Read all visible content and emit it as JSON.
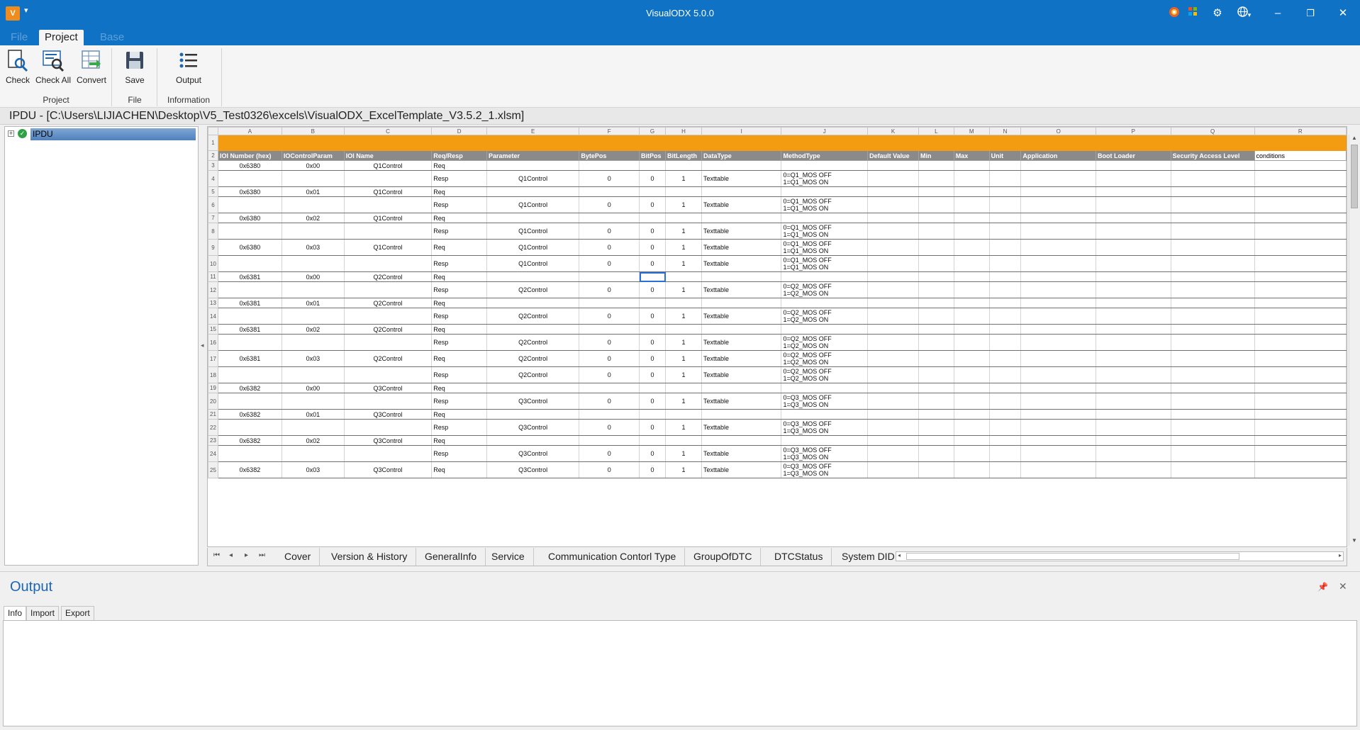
{
  "window": {
    "title": "VisualODX 5.0.0",
    "app_icon_label": "V"
  },
  "ribbon": {
    "tabs": [
      "File",
      "Project",
      "Base"
    ],
    "buttons": {
      "check": "Check",
      "check_all": "Check All",
      "convert": "Convert",
      "save": "Save",
      "output": "Output"
    },
    "groups": {
      "project": "Project",
      "file": "File",
      "information": "Information"
    }
  },
  "path": "IPDU - [C:\\Users\\LIJIACHEN\\Desktop\\V5_Test0326\\excels\\VisualODX_ExcelTemplate_V3.5.2_1.xlsm]",
  "tree": {
    "root": "IPDU"
  },
  "sheet": {
    "columns": [
      "A",
      "B",
      "C",
      "D",
      "E",
      "F",
      "G",
      "H",
      "I",
      "J",
      "K",
      "L",
      "M",
      "N",
      "O",
      "P",
      "Q",
      "R"
    ],
    "headers": [
      "IOI Number (hex)",
      "IOControlParam",
      "IOI Name",
      "Req/Resp",
      "Parameter",
      "BytePos",
      "BitPos",
      "BitLength",
      "DataType",
      "MethodType",
      "Default Value",
      "Min",
      "Max",
      "Unit",
      "Application",
      "Boot Loader",
      "Security Access Level",
      "conditions"
    ],
    "rows": [
      {
        "n": "3",
        "a": "0x6380",
        "b": "0x00",
        "c": "Q1Control",
        "d": "Req",
        "e": "",
        "f": "",
        "g": "",
        "h": "",
        "i": "",
        "j1": "",
        "j2": ""
      },
      {
        "n": "4",
        "a": "",
        "b": "",
        "c": "",
        "d": "Resp",
        "e": "Q1Control",
        "f": "0",
        "g": "0",
        "h": "1",
        "i": "Texttable",
        "j1": "0=Q1_MOS OFF",
        "j2": "1=Q1_MOS ON"
      },
      {
        "n": "5",
        "a": "0x6380",
        "b": "0x01",
        "c": "Q1Control",
        "d": "Req",
        "e": "",
        "f": "",
        "g": "",
        "h": "",
        "i": "",
        "j1": "",
        "j2": ""
      },
      {
        "n": "6",
        "a": "",
        "b": "",
        "c": "",
        "d": "Resp",
        "e": "Q1Control",
        "f": "0",
        "g": "0",
        "h": "1",
        "i": "Texttable",
        "j1": "0=Q1_MOS OFF",
        "j2": "1=Q1_MOS ON"
      },
      {
        "n": "7",
        "a": "0x6380",
        "b": "0x02",
        "c": "Q1Control",
        "d": "Req",
        "e": "",
        "f": "",
        "g": "",
        "h": "",
        "i": "",
        "j1": "",
        "j2": ""
      },
      {
        "n": "8",
        "a": "",
        "b": "",
        "c": "",
        "d": "Resp",
        "e": "Q1Control",
        "f": "0",
        "g": "0",
        "h": "1",
        "i": "Texttable",
        "j1": "0=Q1_MOS OFF",
        "j2": "1=Q1_MOS ON"
      },
      {
        "n": "9",
        "a": "0x6380",
        "b": "0x03",
        "c": "Q1Control",
        "d": "Req",
        "e": "Q1Control",
        "f": "0",
        "g": "0",
        "h": "1",
        "i": "Texttable",
        "j1": "0=Q1_MOS OFF",
        "j2": "1=Q1_MOS ON"
      },
      {
        "n": "10",
        "a": "",
        "b": "",
        "c": "",
        "d": "Resp",
        "e": "Q1Control",
        "f": "0",
        "g": "0",
        "h": "1",
        "i": "Texttable",
        "j1": "0=Q1_MOS OFF",
        "j2": "1=Q1_MOS ON"
      },
      {
        "n": "11",
        "a": "0x6381",
        "b": "0x00",
        "c": "Q2Control",
        "d": "Req",
        "e": "",
        "f": "",
        "g": "",
        "h": "",
        "i": "",
        "j1": "",
        "j2": ""
      },
      {
        "n": "12",
        "a": "",
        "b": "",
        "c": "",
        "d": "Resp",
        "e": "Q2Control",
        "f": "0",
        "g": "0",
        "h": "1",
        "i": "Texttable",
        "j1": "0=Q2_MOS OFF",
        "j2": "1=Q2_MOS ON"
      },
      {
        "n": "13",
        "a": "0x6381",
        "b": "0x01",
        "c": "Q2Control",
        "d": "Req",
        "e": "",
        "f": "",
        "g": "",
        "h": "",
        "i": "",
        "j1": "",
        "j2": ""
      },
      {
        "n": "14",
        "a": "",
        "b": "",
        "c": "",
        "d": "Resp",
        "e": "Q2Control",
        "f": "0",
        "g": "0",
        "h": "1",
        "i": "Texttable",
        "j1": "0=Q2_MOS OFF",
        "j2": "1=Q2_MOS ON"
      },
      {
        "n": "15",
        "a": "0x6381",
        "b": "0x02",
        "c": "Q2Control",
        "d": "Req",
        "e": "",
        "f": "",
        "g": "",
        "h": "",
        "i": "",
        "j1": "",
        "j2": ""
      },
      {
        "n": "16",
        "a": "",
        "b": "",
        "c": "",
        "d": "Resp",
        "e": "Q2Control",
        "f": "0",
        "g": "0",
        "h": "1",
        "i": "Texttable",
        "j1": "0=Q2_MOS OFF",
        "j2": "1=Q2_MOS ON"
      },
      {
        "n": "17",
        "a": "0x6381",
        "b": "0x03",
        "c": "Q2Control",
        "d": "Req",
        "e": "Q2Control",
        "f": "0",
        "g": "0",
        "h": "1",
        "i": "Texttable",
        "j1": "0=Q2_MOS OFF",
        "j2": "1=Q2_MOS ON"
      },
      {
        "n": "18",
        "a": "",
        "b": "",
        "c": "",
        "d": "Resp",
        "e": "Q2Control",
        "f": "0",
        "g": "0",
        "h": "1",
        "i": "Texttable",
        "j1": "0=Q2_MOS OFF",
        "j2": "1=Q2_MOS ON"
      },
      {
        "n": "19",
        "a": "0x6382",
        "b": "0x00",
        "c": "Q3Control",
        "d": "Req",
        "e": "",
        "f": "",
        "g": "",
        "h": "",
        "i": "",
        "j1": "",
        "j2": ""
      },
      {
        "n": "20",
        "a": "",
        "b": "",
        "c": "",
        "d": "Resp",
        "e": "Q3Control",
        "f": "0",
        "g": "0",
        "h": "1",
        "i": "Texttable",
        "j1": "0=Q3_MOS OFF",
        "j2": "1=Q3_MOS ON"
      },
      {
        "n": "21",
        "a": "0x6382",
        "b": "0x01",
        "c": "Q3Control",
        "d": "Req",
        "e": "",
        "f": "",
        "g": "",
        "h": "",
        "i": "",
        "j1": "",
        "j2": ""
      },
      {
        "n": "22",
        "a": "",
        "b": "",
        "c": "",
        "d": "Resp",
        "e": "Q3Control",
        "f": "0",
        "g": "0",
        "h": "1",
        "i": "Texttable",
        "j1": "0=Q3_MOS OFF",
        "j2": "1=Q3_MOS ON"
      },
      {
        "n": "23",
        "a": "0x6382",
        "b": "0x02",
        "c": "Q3Control",
        "d": "Req",
        "e": "",
        "f": "",
        "g": "",
        "h": "",
        "i": "",
        "j1": "",
        "j2": ""
      },
      {
        "n": "24",
        "a": "",
        "b": "",
        "c": "",
        "d": "Resp",
        "e": "Q3Control",
        "f": "0",
        "g": "0",
        "h": "1",
        "i": "Texttable",
        "j1": "0=Q3_MOS OFF",
        "j2": "1=Q3_MOS ON"
      },
      {
        "n": "25",
        "a": "0x6382",
        "b": "0x03",
        "c": "Q3Control",
        "d": "Req",
        "e": "Q3Control",
        "f": "0",
        "g": "0",
        "h": "1",
        "i": "Texttable",
        "j1": "0=Q3_MOS OFF",
        "j2": "1=Q3_MOS ON"
      }
    ],
    "tabs": [
      "Cover",
      "Version & History",
      "GeneralInfo",
      "Service",
      "Communication Contorl Type",
      "GroupOfDTC",
      "DTCStatus",
      "System DID"
    ],
    "header_row_label": "2",
    "orange_row_label": "1"
  },
  "output": {
    "title": "Output",
    "tabs": [
      "Info",
      "Import",
      "Export"
    ]
  },
  "colors": {
    "titlebar": "#1072c4",
    "orange": "#f39c12",
    "header_gray": "#8a8a8a",
    "accent_blue": "#1b66b3"
  }
}
